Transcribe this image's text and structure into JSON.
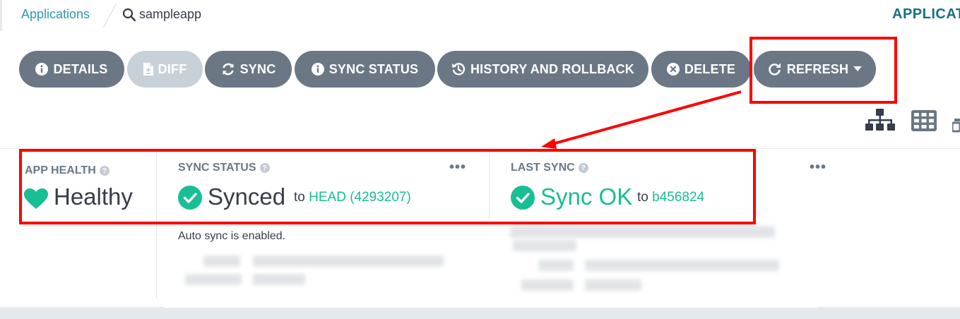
{
  "header": {
    "breadcrumb": "Applications",
    "app_name": "sampleapp",
    "right_title": "APPLICAT"
  },
  "toolbar": {
    "buttons": [
      {
        "label": "DETAILS",
        "icon": "info-circle-icon",
        "disabled": false
      },
      {
        "label": "DIFF",
        "icon": "file-diff-icon",
        "disabled": true
      },
      {
        "label": "SYNC",
        "icon": "sync-icon",
        "disabled": false
      },
      {
        "label": "SYNC STATUS",
        "icon": "info-circle-icon",
        "disabled": false
      },
      {
        "label": "HISTORY AND ROLLBACK",
        "icon": "history-icon",
        "disabled": false
      },
      {
        "label": "DELETE",
        "icon": "times-circle-icon",
        "disabled": false
      },
      {
        "label": "REFRESH",
        "icon": "redo-icon",
        "disabled": false,
        "has_dropdown": true
      }
    ],
    "view_icons": [
      "tree-view-icon",
      "grid-view-icon",
      "network-view-icon"
    ]
  },
  "status": {
    "app_health": {
      "label": "APP HEALTH",
      "value": "Healthy",
      "icon": "heart-icon"
    },
    "sync_status": {
      "label": "SYNC STATUS",
      "value": "Synced",
      "to_prefix": "to",
      "revision": "HEAD (4293207)",
      "note": "Auto sync is enabled.",
      "icon": "check-circle-icon"
    },
    "last_sync": {
      "label": "LAST SYNC",
      "value": "Sync OK",
      "to_prefix": "to",
      "revision": "b456824",
      "icon": "check-circle-icon"
    },
    "more_label": "•••",
    "help_mark": "?"
  },
  "colors": {
    "button_bg": "#6b7784",
    "button_disabled_bg": "#c9d1d8",
    "healthy_green": "#18be94",
    "link_teal": "#2e97a8",
    "annotation_red": "#ff0000"
  }
}
